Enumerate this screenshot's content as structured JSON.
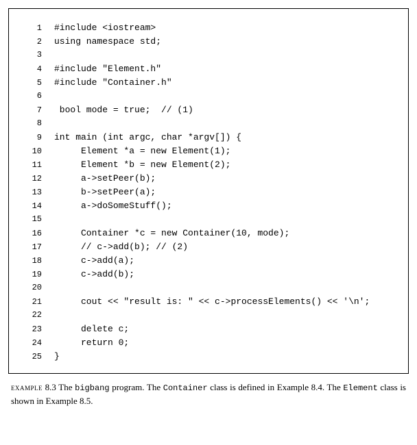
{
  "code": {
    "lines": [
      {
        "n": "1",
        "t": "#include <iostream>"
      },
      {
        "n": "2",
        "t": "using namespace std;"
      },
      {
        "n": "3",
        "t": ""
      },
      {
        "n": "4",
        "t": "#include \"Element.h\""
      },
      {
        "n": "5",
        "t": "#include \"Container.h\""
      },
      {
        "n": "6",
        "t": ""
      },
      {
        "n": "7",
        "t": " bool mode = true;  // (1)"
      },
      {
        "n": "8",
        "t": ""
      },
      {
        "n": "9",
        "t": "int main (int argc, char *argv[]) {"
      },
      {
        "n": "10",
        "t": "     Element *a = new Element(1);"
      },
      {
        "n": "11",
        "t": "     Element *b = new Element(2);"
      },
      {
        "n": "12",
        "t": "     a->setPeer(b);"
      },
      {
        "n": "13",
        "t": "     b->setPeer(a);"
      },
      {
        "n": "14",
        "t": "     a->doSomeStuff();"
      },
      {
        "n": "15",
        "t": ""
      },
      {
        "n": "16",
        "t": "     Container *c = new Container(10, mode);"
      },
      {
        "n": "17",
        "t": "     // c->add(b); // (2)"
      },
      {
        "n": "18",
        "t": "     c->add(a);"
      },
      {
        "n": "19",
        "t": "     c->add(b);"
      },
      {
        "n": "20",
        "t": ""
      },
      {
        "n": "21",
        "t": "     cout << \"result is: \" << c->processElements() << '\\n';"
      },
      {
        "n": "22",
        "t": ""
      },
      {
        "n": "23",
        "t": "     delete c;"
      },
      {
        "n": "24",
        "t": "     return 0;"
      },
      {
        "n": "25",
        "t": "}"
      }
    ]
  },
  "caption": {
    "label": "example",
    "number": "8.3",
    "t1": "The ",
    "program": "bigbang",
    "t2": " program. The ",
    "class1": "Container",
    "t3": " class is defined in Example 8.4. The ",
    "class2": "Element",
    "t4": " class is shown in Example 8.5."
  }
}
